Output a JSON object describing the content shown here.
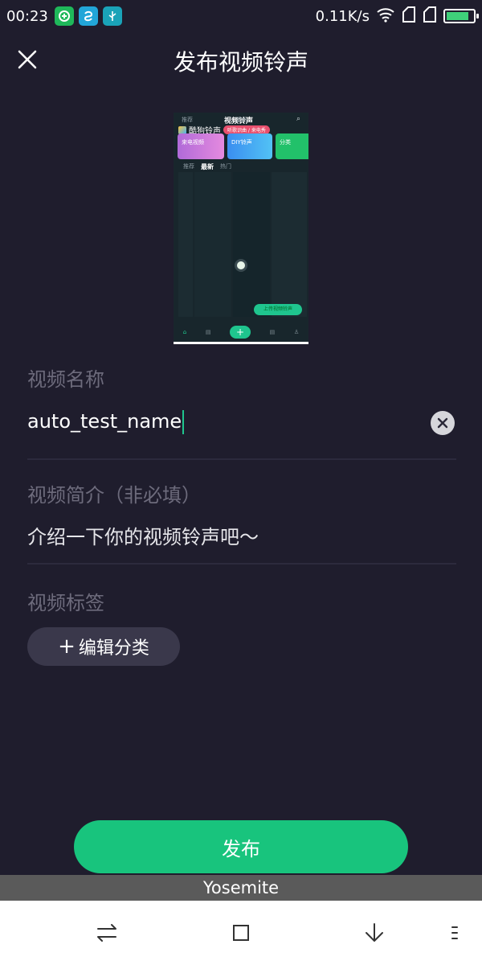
{
  "status_bar": {
    "time": "00:23",
    "net_speed": "0.11K/s",
    "battery_level": 0.85,
    "app_icons": [
      "wechat-icon",
      "app-icon",
      "usb-icon"
    ]
  },
  "header": {
    "title": "发布视频铃声"
  },
  "preview": {
    "top_left_tab": "推荐",
    "top_title": "视频铃声",
    "top_right_tab": "壁纸",
    "brand": "酷狗铃声",
    "pill": "听歌识曲 / 来电秀",
    "cards": [
      "来电视频",
      "DIY铃声",
      "分类"
    ],
    "tabs": [
      "推荐",
      "最新",
      "热门"
    ],
    "cta": "上传视频铃声"
  },
  "form": {
    "name_label": "视频名称",
    "name_value": "auto_test_name",
    "desc_label": "视频简介（非必填）",
    "desc_placeholder": "介绍一下你的视频铃声吧～",
    "tags_label": "视频标签",
    "tag_button_plus": "+",
    "tag_button_label": "编辑分类"
  },
  "publish_label": "发布",
  "toast": "Yosemite",
  "colors": {
    "background": "#1f1d2d",
    "accent": "#18c47d",
    "label": "#6d6b7c"
  }
}
